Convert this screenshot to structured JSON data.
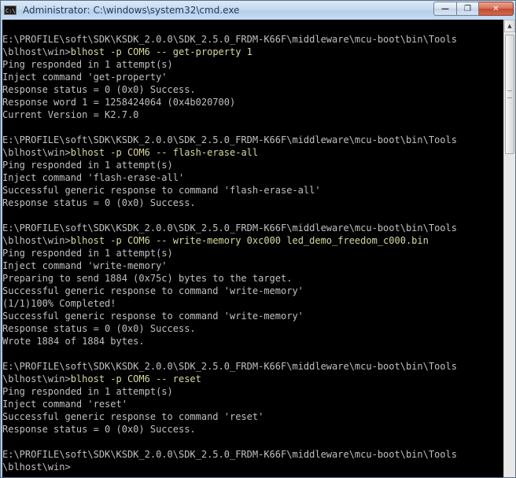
{
  "window": {
    "title": "Administrator: C:\\windows\\system32\\cmd.exe",
    "icon_text": "C:\\",
    "minimize_glyph": "—",
    "maximize_glyph": "❐",
    "close_glyph": "✕"
  },
  "scrollbar": {
    "up_glyph": "▲"
  },
  "console": {
    "lines": [
      {
        "text": "E:\\PROFILE\\soft\\SDK\\KSDK_2.0.0\\SDK_2.5.0_FRDM-K66F\\middleware\\mcu-boot\\bin\\Tools",
        "type": "path"
      },
      {
        "text": "\\blhost\\win>",
        "cmd": "blhost -p COM6 -- get-property 1",
        "type": "prompt"
      },
      {
        "text": "Ping responded in 1 attempt(s)",
        "type": "out"
      },
      {
        "text": "Inject command 'get-property'",
        "type": "out"
      },
      {
        "text": "Response status = 0 (0x0) Success.",
        "type": "out"
      },
      {
        "text": "Response word 1 = 1258424064 (0x4b020700)",
        "type": "out"
      },
      {
        "text": "Current Version = K2.7.0",
        "type": "out"
      },
      {
        "text": "",
        "type": "blank"
      },
      {
        "text": "E:\\PROFILE\\soft\\SDK\\KSDK_2.0.0\\SDK_2.5.0_FRDM-K66F\\middleware\\mcu-boot\\bin\\Tools",
        "type": "path"
      },
      {
        "text": "\\blhost\\win>",
        "cmd": "blhost -p COM6 -- flash-erase-all",
        "type": "prompt"
      },
      {
        "text": "Ping responded in 1 attempt(s)",
        "type": "out"
      },
      {
        "text": "Inject command 'flash-erase-all'",
        "type": "out"
      },
      {
        "text": "Successful generic response to command 'flash-erase-all'",
        "type": "out"
      },
      {
        "text": "Response status = 0 (0x0) Success.",
        "type": "out"
      },
      {
        "text": "",
        "type": "blank"
      },
      {
        "text": "E:\\PROFILE\\soft\\SDK\\KSDK_2.0.0\\SDK_2.5.0_FRDM-K66F\\middleware\\mcu-boot\\bin\\Tools",
        "type": "path"
      },
      {
        "text": "\\blhost\\win>",
        "cmd": "blhost -p COM6 -- write-memory 0xc000 led_demo_freedom_c000.bin",
        "type": "prompt"
      },
      {
        "text": "Ping responded in 1 attempt(s)",
        "type": "out"
      },
      {
        "text": "Inject command 'write-memory'",
        "type": "out"
      },
      {
        "text": "Preparing to send 1884 (0x75c) bytes to the target.",
        "type": "out"
      },
      {
        "text": "Successful generic response to command 'write-memory'",
        "type": "out"
      },
      {
        "text": "(1/1)100% Completed!",
        "type": "out"
      },
      {
        "text": "Successful generic response to command 'write-memory'",
        "type": "out"
      },
      {
        "text": "Response status = 0 (0x0) Success.",
        "type": "out"
      },
      {
        "text": "Wrote 1884 of 1884 bytes.",
        "type": "out"
      },
      {
        "text": "",
        "type": "blank"
      },
      {
        "text": "E:\\PROFILE\\soft\\SDK\\KSDK_2.0.0\\SDK_2.5.0_FRDM-K66F\\middleware\\mcu-boot\\bin\\Tools",
        "type": "path"
      },
      {
        "text": "\\blhost\\win>",
        "cmd": "blhost -p COM6 -- reset",
        "type": "prompt"
      },
      {
        "text": "Ping responded in 1 attempt(s)",
        "type": "out"
      },
      {
        "text": "Inject command 'reset'",
        "type": "out"
      },
      {
        "text": "Successful generic response to command 'reset'",
        "type": "out"
      },
      {
        "text": "Response status = 0 (0x0) Success.",
        "type": "out"
      },
      {
        "text": "",
        "type": "blank"
      },
      {
        "text": "E:\\PROFILE\\soft\\SDK\\KSDK_2.0.0\\SDK_2.5.0_FRDM-K66F\\middleware\\mcu-boot\\bin\\Tools",
        "type": "path"
      },
      {
        "text": "\\blhost\\win>",
        "type": "prompt-empty"
      }
    ]
  },
  "colors": {
    "console_bg": "#000000",
    "console_text": "#c0c0c0",
    "command_text": "#d8d8a0",
    "title_text": "#1e395b"
  }
}
